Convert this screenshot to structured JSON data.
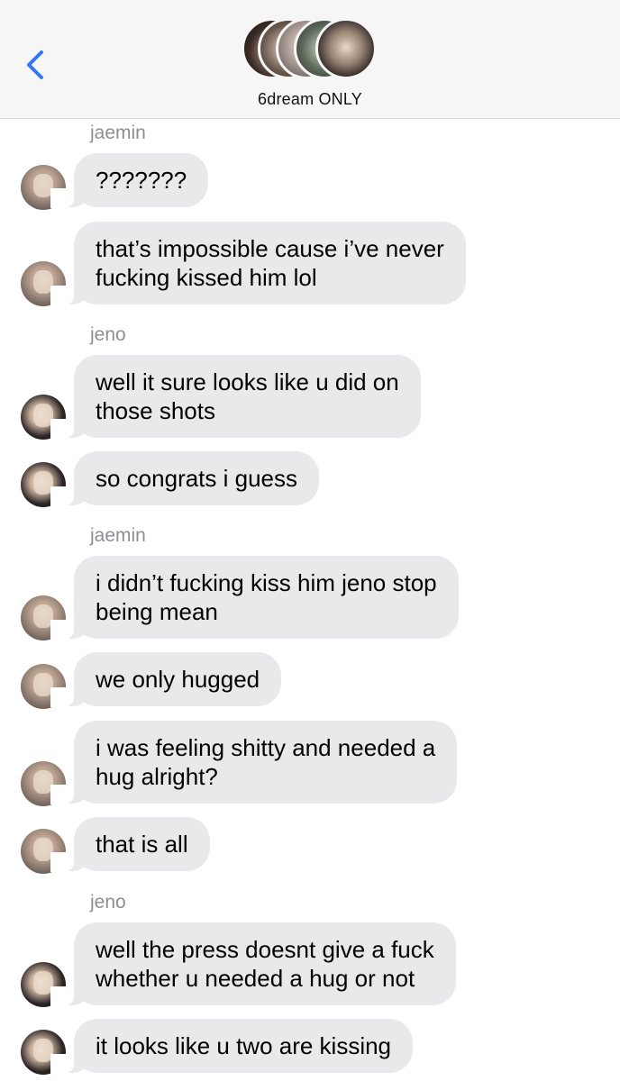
{
  "header": {
    "back_icon": "chevron-left-icon",
    "group_name": "6dream ONLY",
    "accent_color": "#3478f6"
  },
  "messages": [
    {
      "sender_label": "jaemin"
    },
    {
      "text": "???????",
      "sender": "jaemin"
    },
    {
      "text": "that’s impossible cause i’ve never\nfucking kissed him lol",
      "sender": "jaemin"
    },
    {
      "sender_label": "jeno"
    },
    {
      "text": "well it sure looks like u did on\nthose shots",
      "sender": "jeno"
    },
    {
      "text": "so congrats i guess",
      "sender": "jeno"
    },
    {
      "sender_label": "jaemin"
    },
    {
      "text": "i didn’t fucking kiss him jeno stop\nbeing mean",
      "sender": "jaemin"
    },
    {
      "text": "we only hugged",
      "sender": "jaemin"
    },
    {
      "text": "i was feeling shitty and needed a\nhug alright?",
      "sender": "jaemin"
    },
    {
      "text": "that is all",
      "sender": "jaemin"
    },
    {
      "sender_label": "jeno"
    },
    {
      "text": "well the press doesnt give a fuck\nwhether u needed a hug or not",
      "sender": "jeno"
    },
    {
      "text": "it looks like u two are kissing",
      "sender": "jeno"
    }
  ],
  "colors": {
    "bubble_incoming": "#e9e9eb",
    "header_bg": "#f6f6f6",
    "sender_label": "#8e8e93"
  }
}
